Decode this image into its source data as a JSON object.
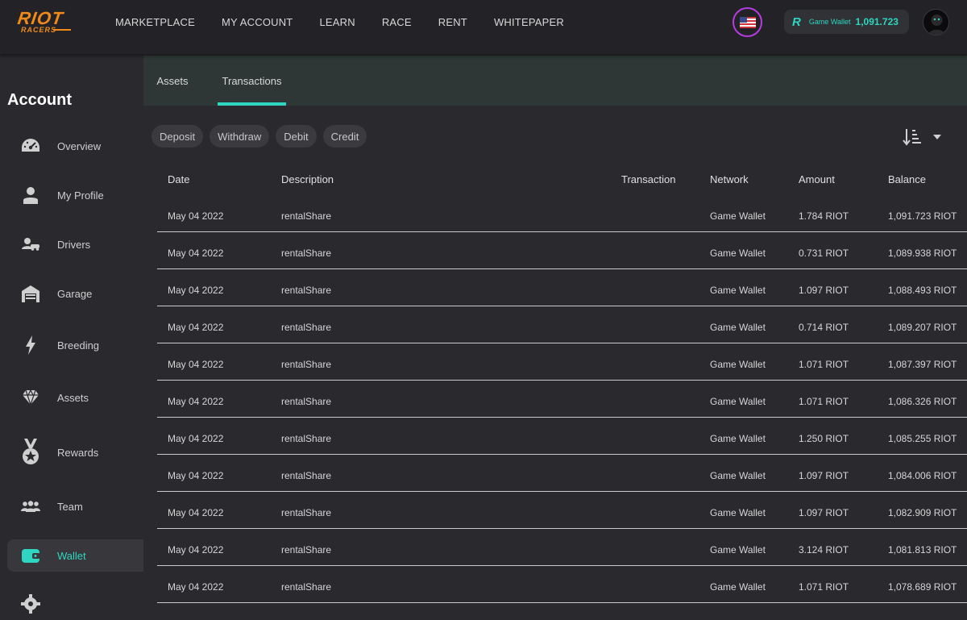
{
  "brand": {
    "logo_top": "RIOT",
    "logo_bottom": "RACERS"
  },
  "nav": [
    "MARKETPLACE",
    "MY ACCOUNT",
    "LEARN",
    "RACE",
    "RENT",
    "WHITEPAPER"
  ],
  "wallet": {
    "icon": "R",
    "label": "Game Wallet",
    "value": "1,091.723",
    "accent": "#2ed6c2"
  },
  "sidebar": {
    "title": "Account",
    "items": [
      {
        "label": "Overview",
        "icon": "speedometer-icon"
      },
      {
        "label": "My Profile",
        "icon": "user-icon"
      },
      {
        "label": "Drivers",
        "icon": "driver-icon"
      },
      {
        "label": "Garage",
        "icon": "garage-icon"
      },
      {
        "label": "Breeding",
        "icon": "lightning-icon"
      },
      {
        "label": "Assets",
        "icon": "diamond-icon"
      },
      {
        "label": "Rewards",
        "icon": "medal-icon"
      },
      {
        "label": "Team",
        "icon": "team-icon"
      },
      {
        "label": "Wallet",
        "icon": "wallet-icon",
        "active": true
      }
    ]
  },
  "tabs": [
    {
      "label": "Assets"
    },
    {
      "label": "Transactions",
      "active": true
    }
  ],
  "filters": [
    "Deposit",
    "Withdraw",
    "Debit",
    "Credit"
  ],
  "table": {
    "headers": [
      "Date",
      "Description",
      "Transaction",
      "Network",
      "Amount",
      "Balance"
    ],
    "rows": [
      [
        "May 04 2022",
        "rentalShare",
        "",
        "Game Wallet",
        "1.784 RIOT",
        "1,091.723 RIOT"
      ],
      [
        "May 04 2022",
        "rentalShare",
        "",
        "Game Wallet",
        "0.731 RIOT",
        "1,089.938 RIOT"
      ],
      [
        "May 04 2022",
        "rentalShare",
        "",
        "Game Wallet",
        "1.097 RIOT",
        "1,088.493 RIOT"
      ],
      [
        "May 04 2022",
        "rentalShare",
        "",
        "Game Wallet",
        "0.714 RIOT",
        "1,089.207 RIOT"
      ],
      [
        "May 04 2022",
        "rentalShare",
        "",
        "Game Wallet",
        "1.071 RIOT",
        "1,087.397 RIOT"
      ],
      [
        "May 04 2022",
        "rentalShare",
        "",
        "Game Wallet",
        "1.071 RIOT",
        "1,086.326 RIOT"
      ],
      [
        "May 04 2022",
        "rentalShare",
        "",
        "Game Wallet",
        "1.250 RIOT",
        "1,085.255 RIOT"
      ],
      [
        "May 04 2022",
        "rentalShare",
        "",
        "Game Wallet",
        "1.097 RIOT",
        "1,084.006 RIOT"
      ],
      [
        "May 04 2022",
        "rentalShare",
        "",
        "Game Wallet",
        "1.097 RIOT",
        "1,082.909 RIOT"
      ],
      [
        "May 04 2022",
        "rentalShare",
        "",
        "Game Wallet",
        "3.124 RIOT",
        "1,081.813 RIOT"
      ],
      [
        "May 04 2022",
        "rentalShare",
        "",
        "Game Wallet",
        "1.071 RIOT",
        "1,078.689 RIOT"
      ]
    ]
  }
}
